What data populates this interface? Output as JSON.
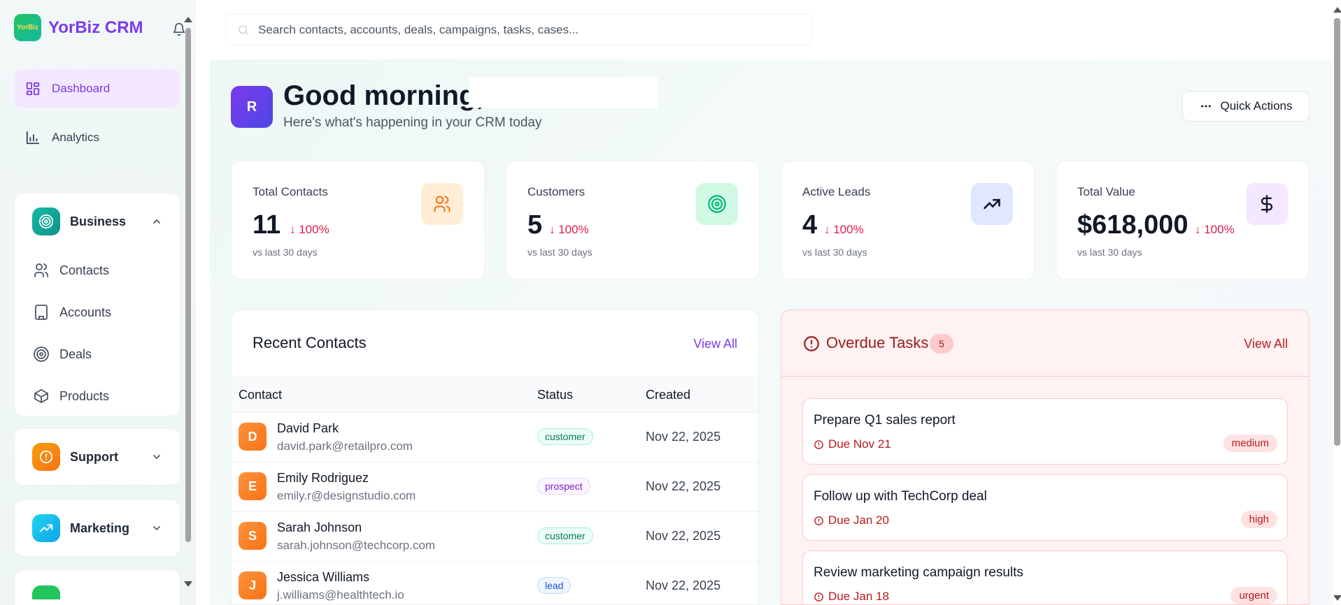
{
  "brand": {
    "logo_text": "YorBiz",
    "name": "YorBiz CRM"
  },
  "sidebar": {
    "nav": [
      {
        "label": "Dashboard",
        "icon": "grid-icon",
        "active": true
      },
      {
        "label": "Analytics",
        "icon": "bar-chart-icon",
        "active": false
      }
    ],
    "groups": [
      {
        "label": "Business",
        "icon": "target-icon",
        "color": "#14b8a6",
        "expanded": true,
        "items": [
          {
            "label": "Contacts",
            "icon": "users-icon"
          },
          {
            "label": "Accounts",
            "icon": "building-icon"
          },
          {
            "label": "Deals",
            "icon": "target-icon"
          },
          {
            "label": "Products",
            "icon": "box-icon"
          }
        ]
      },
      {
        "label": "Support",
        "icon": "alert-circle-icon",
        "color": "#f97316",
        "expanded": false
      },
      {
        "label": "Marketing",
        "icon": "trending-up-icon",
        "color": "#0ea5e9",
        "expanded": false
      }
    ]
  },
  "search": {
    "placeholder": "Search contacts, accounts, deals, campaigns, tasks, cases..."
  },
  "header": {
    "avatar_initial": "R",
    "greeting": "Good morning,",
    "subtitle": "Here's what's happening in your CRM today",
    "quick_actions": "Quick Actions"
  },
  "stats": [
    {
      "label": "Total Contacts",
      "value": "11",
      "delta": "↓ 100%",
      "foot": "vs last 30 days",
      "icon": "users-icon",
      "color": "#f97316"
    },
    {
      "label": "Customers",
      "value": "5",
      "delta": "↓ 100%",
      "foot": "vs last 30 days",
      "icon": "target-icon",
      "color": "#10b981"
    },
    {
      "label": "Active Leads",
      "value": "4",
      "delta": "↓ 100%",
      "foot": "vs last 30 days",
      "icon": "trending-up-icon",
      "color": "#1e293b"
    },
    {
      "label": "Total Value",
      "value": "$618,000",
      "delta": "↓ 100%",
      "foot": "vs last 30 days",
      "icon": "dollar-icon",
      "color": "#1e293b"
    }
  ],
  "recent_contacts": {
    "title": "Recent Contacts",
    "view_all": "View All",
    "columns": [
      "Contact",
      "Status",
      "Created"
    ],
    "rows": [
      {
        "initial": "D",
        "name": "David Park",
        "email": "david.park@retailpro.com",
        "status": "customer",
        "created": "Nov 22, 2025"
      },
      {
        "initial": "E",
        "name": "Emily Rodriguez",
        "email": "emily.r@designstudio.com",
        "status": "prospect",
        "created": "Nov 22, 2025"
      },
      {
        "initial": "S",
        "name": "Sarah Johnson",
        "email": "sarah.johnson@techcorp.com",
        "status": "customer",
        "created": "Nov 22, 2025"
      },
      {
        "initial": "J",
        "name": "Jessica Williams",
        "email": "j.williams@healthtech.io",
        "status": "lead",
        "created": "Nov 22, 2025"
      }
    ]
  },
  "overdue_tasks": {
    "title": "Overdue Tasks",
    "count": "5",
    "view_all": "View All",
    "items": [
      {
        "title": "Prepare Q1 sales report",
        "due": "Due Nov 21",
        "priority": "medium"
      },
      {
        "title": "Follow up with TechCorp deal",
        "due": "Due Jan 20",
        "priority": "high"
      },
      {
        "title": "Review marketing campaign results",
        "due": "Due Jan 18",
        "priority": "urgent"
      }
    ]
  }
}
